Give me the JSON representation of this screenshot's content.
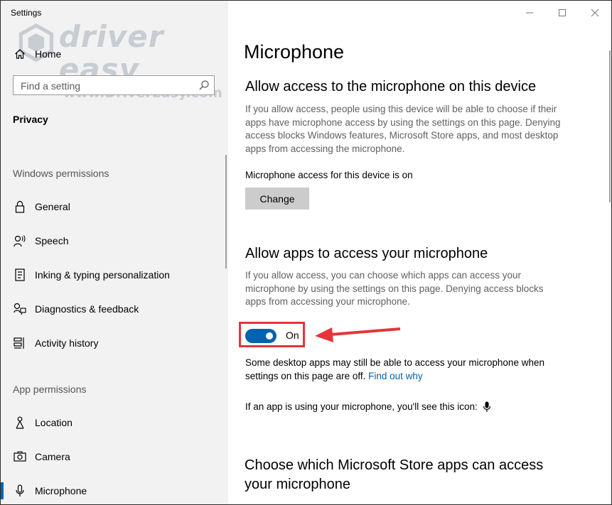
{
  "window": {
    "title": "Settings",
    "controls": [
      "minimize-icon",
      "maximize-icon",
      "close-icon"
    ]
  },
  "watermark": {
    "brand": "driver easy",
    "url": "www.DriverEasy.com"
  },
  "sidebar": {
    "home_label": "Home",
    "search_placeholder": "Find a setting",
    "category": "Privacy",
    "windows_permissions_label": "Windows permissions",
    "windows_items": [
      {
        "label": "General",
        "icon": "lock-icon"
      },
      {
        "label": "Speech",
        "icon": "speech-icon"
      },
      {
        "label": "Inking & typing personalization",
        "icon": "inking-icon"
      },
      {
        "label": "Diagnostics & feedback",
        "icon": "diagnostics-icon"
      },
      {
        "label": "Activity history",
        "icon": "activity-history-icon"
      }
    ],
    "app_permissions_label": "App permissions",
    "app_items": [
      {
        "label": "Location",
        "icon": "location-icon"
      },
      {
        "label": "Camera",
        "icon": "camera-icon"
      },
      {
        "label": "Microphone",
        "icon": "microphone-icon",
        "active": true
      }
    ]
  },
  "main": {
    "title": "Microphone",
    "device_section": {
      "heading": "Allow access to the microphone on this device",
      "description": "If you allow access, people using this device will be able to choose if their apps have microphone access by using the settings on this page. Denying access blocks Windows features, Microsoft Store apps, and most desktop apps from accessing the microphone.",
      "status": "Microphone access for this device is on",
      "button_label": "Change"
    },
    "apps_section": {
      "heading": "Allow apps to access your microphone",
      "description": "If you allow access, you can choose which apps can access your microphone by using the settings on this page. Denying access blocks apps from accessing your microphone.",
      "toggle_state": "On",
      "note": "Some desktop apps may still be able to access your microphone when settings on this page are off.",
      "link": "Find out why",
      "icon_note": "If an app is using your microphone, you'll see this icon:"
    },
    "store_section": {
      "heading_line1": "Choose which Microsoft Store apps can access",
      "heading_line2": "your microphone"
    }
  },
  "colors": {
    "accent": "#0063b1",
    "highlight": "#e5353a",
    "sidebar_bg": "#f2f2f2"
  }
}
